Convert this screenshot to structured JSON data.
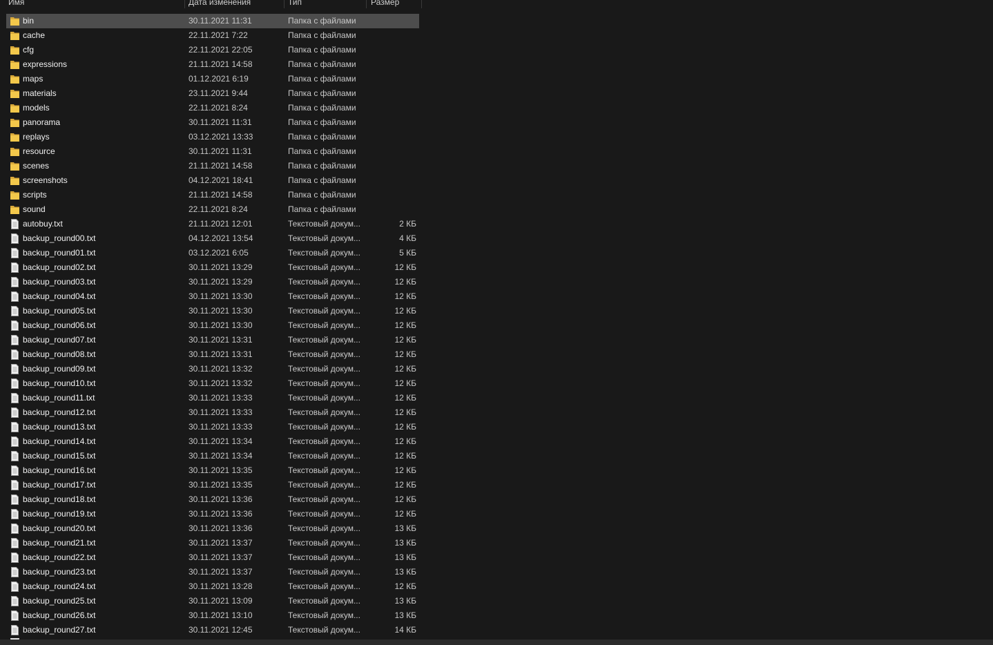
{
  "columns": {
    "name": "Имя",
    "date": "Дата изменения",
    "type": "Тип",
    "size": "Размер"
  },
  "colors": {
    "background": "#191919",
    "selected_row": "#4d4d4d",
    "folder": "#f3c84b",
    "file": "#f2f2f2"
  },
  "files": [
    {
      "name": "bin",
      "date": "30.11.2021 11:31",
      "type": "Папка с файлами",
      "size": "",
      "icon": "folder-icon",
      "selected": true
    },
    {
      "name": "cache",
      "date": "22.11.2021 7:22",
      "type": "Папка с файлами",
      "size": "",
      "icon": "folder-icon"
    },
    {
      "name": "cfg",
      "date": "22.11.2021 22:05",
      "type": "Папка с файлами",
      "size": "",
      "icon": "folder-icon"
    },
    {
      "name": "expressions",
      "date": "21.11.2021 14:58",
      "type": "Папка с файлами",
      "size": "",
      "icon": "folder-icon"
    },
    {
      "name": "maps",
      "date": "01.12.2021 6:19",
      "type": "Папка с файлами",
      "size": "",
      "icon": "folder-icon"
    },
    {
      "name": "materials",
      "date": "23.11.2021 9:44",
      "type": "Папка с файлами",
      "size": "",
      "icon": "folder-icon"
    },
    {
      "name": "models",
      "date": "22.11.2021 8:24",
      "type": "Папка с файлами",
      "size": "",
      "icon": "folder-icon"
    },
    {
      "name": "panorama",
      "date": "30.11.2021 11:31",
      "type": "Папка с файлами",
      "size": "",
      "icon": "folder-icon"
    },
    {
      "name": "replays",
      "date": "03.12.2021 13:33",
      "type": "Папка с файлами",
      "size": "",
      "icon": "folder-icon"
    },
    {
      "name": "resource",
      "date": "30.11.2021 11:31",
      "type": "Папка с файлами",
      "size": "",
      "icon": "folder-icon"
    },
    {
      "name": "scenes",
      "date": "21.11.2021 14:58",
      "type": "Папка с файлами",
      "size": "",
      "icon": "folder-icon"
    },
    {
      "name": "screenshots",
      "date": "04.12.2021 18:41",
      "type": "Папка с файлами",
      "size": "",
      "icon": "folder-icon"
    },
    {
      "name": "scripts",
      "date": "21.11.2021 14:58",
      "type": "Папка с файлами",
      "size": "",
      "icon": "folder-icon"
    },
    {
      "name": "sound",
      "date": "22.11.2021 8:24",
      "type": "Папка с файлами",
      "size": "",
      "icon": "folder-icon"
    },
    {
      "name": "autobuy.txt",
      "date": "21.11.2021 12:01",
      "type": "Текстовый докум...",
      "size": "2 КБ",
      "icon": "text-file-icon"
    },
    {
      "name": "backup_round00.txt",
      "date": "04.12.2021 13:54",
      "type": "Текстовый докум...",
      "size": "4 КБ",
      "icon": "text-file-icon"
    },
    {
      "name": "backup_round01.txt",
      "date": "03.12.2021 6:05",
      "type": "Текстовый докум...",
      "size": "5 КБ",
      "icon": "text-file-icon"
    },
    {
      "name": "backup_round02.txt",
      "date": "30.11.2021 13:29",
      "type": "Текстовый докум...",
      "size": "12 КБ",
      "icon": "text-file-icon"
    },
    {
      "name": "backup_round03.txt",
      "date": "30.11.2021 13:29",
      "type": "Текстовый докум...",
      "size": "12 КБ",
      "icon": "text-file-icon"
    },
    {
      "name": "backup_round04.txt",
      "date": "30.11.2021 13:30",
      "type": "Текстовый докум...",
      "size": "12 КБ",
      "icon": "text-file-icon"
    },
    {
      "name": "backup_round05.txt",
      "date": "30.11.2021 13:30",
      "type": "Текстовый докум...",
      "size": "12 КБ",
      "icon": "text-file-icon"
    },
    {
      "name": "backup_round06.txt",
      "date": "30.11.2021 13:30",
      "type": "Текстовый докум...",
      "size": "12 КБ",
      "icon": "text-file-icon"
    },
    {
      "name": "backup_round07.txt",
      "date": "30.11.2021 13:31",
      "type": "Текстовый докум...",
      "size": "12 КБ",
      "icon": "text-file-icon"
    },
    {
      "name": "backup_round08.txt",
      "date": "30.11.2021 13:31",
      "type": "Текстовый докум...",
      "size": "12 КБ",
      "icon": "text-file-icon"
    },
    {
      "name": "backup_round09.txt",
      "date": "30.11.2021 13:32",
      "type": "Текстовый докум...",
      "size": "12 КБ",
      "icon": "text-file-icon"
    },
    {
      "name": "backup_round10.txt",
      "date": "30.11.2021 13:32",
      "type": "Текстовый докум...",
      "size": "12 КБ",
      "icon": "text-file-icon"
    },
    {
      "name": "backup_round11.txt",
      "date": "30.11.2021 13:33",
      "type": "Текстовый докум...",
      "size": "12 КБ",
      "icon": "text-file-icon"
    },
    {
      "name": "backup_round12.txt",
      "date": "30.11.2021 13:33",
      "type": "Текстовый докум...",
      "size": "12 КБ",
      "icon": "text-file-icon"
    },
    {
      "name": "backup_round13.txt",
      "date": "30.11.2021 13:33",
      "type": "Текстовый докум...",
      "size": "12 КБ",
      "icon": "text-file-icon"
    },
    {
      "name": "backup_round14.txt",
      "date": "30.11.2021 13:34",
      "type": "Текстовый докум...",
      "size": "12 КБ",
      "icon": "text-file-icon"
    },
    {
      "name": "backup_round15.txt",
      "date": "30.11.2021 13:34",
      "type": "Текстовый докум...",
      "size": "12 КБ",
      "icon": "text-file-icon"
    },
    {
      "name": "backup_round16.txt",
      "date": "30.11.2021 13:35",
      "type": "Текстовый докум...",
      "size": "12 КБ",
      "icon": "text-file-icon"
    },
    {
      "name": "backup_round17.txt",
      "date": "30.11.2021 13:35",
      "type": "Текстовый докум...",
      "size": "12 КБ",
      "icon": "text-file-icon"
    },
    {
      "name": "backup_round18.txt",
      "date": "30.11.2021 13:36",
      "type": "Текстовый докум...",
      "size": "12 КБ",
      "icon": "text-file-icon"
    },
    {
      "name": "backup_round19.txt",
      "date": "30.11.2021 13:36",
      "type": "Текстовый докум...",
      "size": "12 КБ",
      "icon": "text-file-icon"
    },
    {
      "name": "backup_round20.txt",
      "date": "30.11.2021 13:36",
      "type": "Текстовый докум...",
      "size": "13 КБ",
      "icon": "text-file-icon"
    },
    {
      "name": "backup_round21.txt",
      "date": "30.11.2021 13:37",
      "type": "Текстовый докум...",
      "size": "13 КБ",
      "icon": "text-file-icon"
    },
    {
      "name": "backup_round22.txt",
      "date": "30.11.2021 13:37",
      "type": "Текстовый докум...",
      "size": "13 КБ",
      "icon": "text-file-icon"
    },
    {
      "name": "backup_round23.txt",
      "date": "30.11.2021 13:37",
      "type": "Текстовый докум...",
      "size": "13 КБ",
      "icon": "text-file-icon"
    },
    {
      "name": "backup_round24.txt",
      "date": "30.11.2021 13:28",
      "type": "Текстовый докум...",
      "size": "12 КБ",
      "icon": "text-file-icon"
    },
    {
      "name": "backup_round25.txt",
      "date": "30.11.2021 13:09",
      "type": "Текстовый докум...",
      "size": "13 КБ",
      "icon": "text-file-icon"
    },
    {
      "name": "backup_round26.txt",
      "date": "30.11.2021 13:10",
      "type": "Текстовый докум...",
      "size": "13 КБ",
      "icon": "text-file-icon"
    },
    {
      "name": "backup_round27.txt",
      "date": "30.11.2021 12:45",
      "type": "Текстовый докум...",
      "size": "14 КБ",
      "icon": "text-file-icon"
    }
  ]
}
